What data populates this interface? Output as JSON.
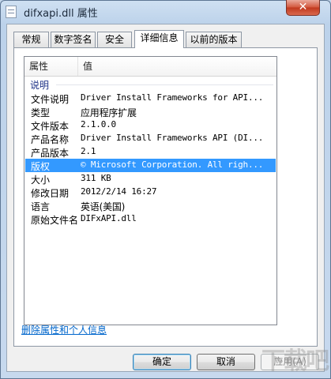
{
  "window": {
    "title": "difxapi.dll 属性",
    "close_label": "✕"
  },
  "tabs": [
    {
      "label": "常规"
    },
    {
      "label": "数字签名"
    },
    {
      "label": "安全"
    },
    {
      "label": "详细信息",
      "active": true
    },
    {
      "label": "以前的版本"
    }
  ],
  "list": {
    "columns": {
      "property": "属性",
      "value": "值"
    },
    "group": "说明",
    "rows": [
      {
        "key": "文件说明",
        "value": "Driver Install Frameworks for API..."
      },
      {
        "key": "类型",
        "value": "应用程序扩展"
      },
      {
        "key": "文件版本",
        "value": "2.1.0.0"
      },
      {
        "key": "产品名称",
        "value": "Driver Install Frameworks API (DI..."
      },
      {
        "key": "产品版本",
        "value": "2.1"
      },
      {
        "key": "版权",
        "value": "© Microsoft Corporation. All righ...",
        "selected": true
      },
      {
        "key": "大小",
        "value": "311 KB"
      },
      {
        "key": "修改日期",
        "value": "2012/2/14 16:27"
      },
      {
        "key": "语言",
        "value": "英语(美国)"
      },
      {
        "key": "原始文件名",
        "value": "DIFxAPI.dll"
      }
    ]
  },
  "remove_link": "删除属性和个人信息",
  "buttons": {
    "ok": "确定",
    "cancel": "取消",
    "apply": "应用(A)"
  },
  "watermark": "下载吧",
  "colors": {
    "selection": "#3399ff",
    "link": "#0066cc",
    "group_label": "#1e3287"
  }
}
